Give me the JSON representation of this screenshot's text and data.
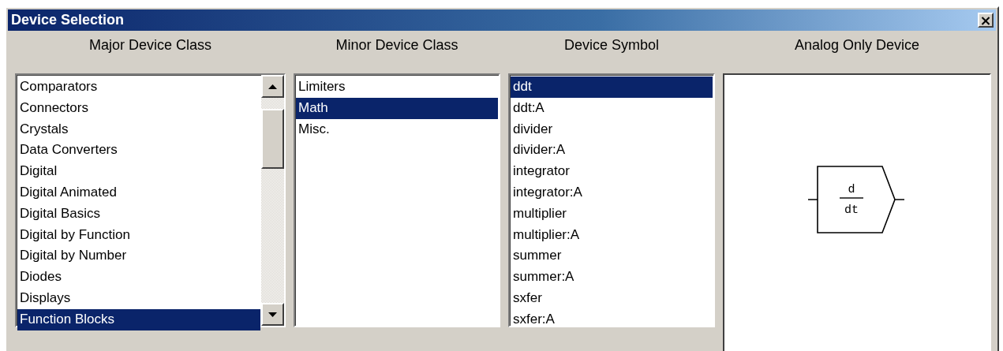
{
  "window": {
    "title": "Device Selection",
    "close": "×"
  },
  "columns": [
    {
      "heading": "Major Device Class",
      "kind": "list",
      "scrollbar": true,
      "items": [
        {
          "label": "Comparators",
          "selected": false
        },
        {
          "label": "Connectors",
          "selected": false
        },
        {
          "label": "Crystals",
          "selected": false
        },
        {
          "label": "Data Converters",
          "selected": false
        },
        {
          "label": "Digital",
          "selected": false
        },
        {
          "label": "Digital Animated",
          "selected": false
        },
        {
          "label": "Digital Basics",
          "selected": false
        },
        {
          "label": "Digital by Function",
          "selected": false
        },
        {
          "label": "Digital by Number",
          "selected": false
        },
        {
          "label": "Diodes",
          "selected": false
        },
        {
          "label": "Displays",
          "selected": false
        },
        {
          "label": "Function Blocks",
          "selected": true
        }
      ]
    },
    {
      "heading": "Minor Device Class",
      "kind": "list",
      "scrollbar": false,
      "items": [
        {
          "label": "Limiters",
          "selected": false
        },
        {
          "label": "Math",
          "selected": true
        },
        {
          "label": "Misc.",
          "selected": false
        }
      ]
    },
    {
      "heading": "Device Symbol",
      "kind": "list",
      "scrollbar": false,
      "items": [
        {
          "label": "ddt",
          "selected": true
        },
        {
          "label": "ddt:A",
          "selected": false
        },
        {
          "label": "divider",
          "selected": false
        },
        {
          "label": "divider:A",
          "selected": false
        },
        {
          "label": "integrator",
          "selected": false
        },
        {
          "label": "integrator:A",
          "selected": false
        },
        {
          "label": "multiplier",
          "selected": false
        },
        {
          "label": "multiplier:A",
          "selected": false
        },
        {
          "label": "summer",
          "selected": false
        },
        {
          "label": "summer:A",
          "selected": false
        },
        {
          "label": "sxfer",
          "selected": false
        },
        {
          "label": "sxfer:A",
          "selected": false
        }
      ]
    },
    {
      "heading": "Analog Only Device",
      "kind": "preview",
      "symbol": {
        "numerator": "d",
        "denominator": "dt"
      }
    }
  ]
}
